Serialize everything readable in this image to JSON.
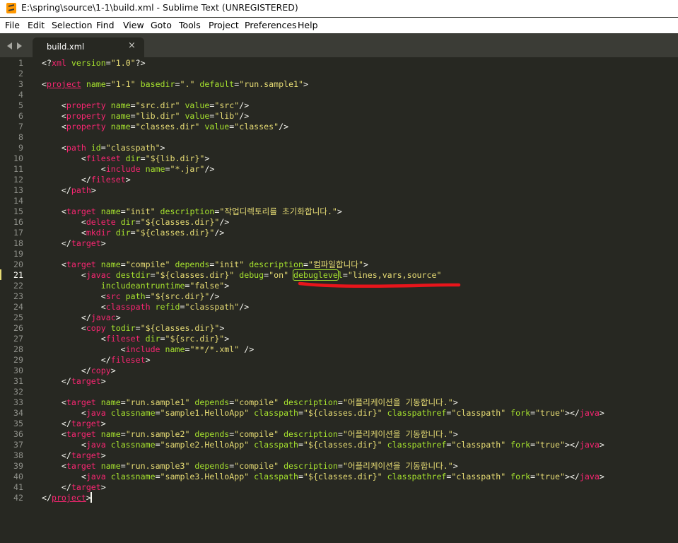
{
  "window": {
    "title": "E:\\spring\\source\\1-1\\build.xml - Sublime Text (UNREGISTERED)",
    "logo_icon": "sublime-text-logo"
  },
  "menu": [
    "File",
    "Edit",
    "Selection",
    "Find",
    "View",
    "Goto",
    "Tools",
    "Project",
    "Preferences",
    "Help"
  ],
  "tabs": [
    {
      "label": "build.xml",
      "close": "×",
      "active": true
    }
  ],
  "editor": {
    "active_line": 21,
    "colors": {
      "background": "#272822",
      "tag": "#f92672",
      "attribute": "#a6e22e",
      "string": "#e6db74",
      "text": "#f8f8f2",
      "line_number": "#8f908a",
      "annotation": "#e8151b"
    },
    "lines": [
      [
        [
          "p",
          "<?"
        ],
        [
          "t",
          "xml"
        ],
        [
          "a",
          " version"
        ],
        [
          "p",
          "="
        ],
        [
          "s",
          "\"1.0\""
        ],
        [
          "p",
          "?>"
        ]
      ],
      [],
      [
        [
          "p",
          "<"
        ],
        [
          "tu",
          "project"
        ],
        [
          "a",
          " name"
        ],
        [
          "p",
          "="
        ],
        [
          "s",
          "\"1-1\""
        ],
        [
          "a",
          " basedir"
        ],
        [
          "p",
          "="
        ],
        [
          "s",
          "\".\""
        ],
        [
          "a",
          " default"
        ],
        [
          "p",
          "="
        ],
        [
          "s",
          "\"run.sample1\""
        ],
        [
          "p",
          ">"
        ]
      ],
      [],
      [
        [
          "p",
          "    <"
        ],
        [
          "t",
          "property"
        ],
        [
          "a",
          " name"
        ],
        [
          "p",
          "="
        ],
        [
          "s",
          "\"src.dir\""
        ],
        [
          "a",
          " value"
        ],
        [
          "p",
          "="
        ],
        [
          "s",
          "\"src\""
        ],
        [
          "p",
          "/>"
        ]
      ],
      [
        [
          "p",
          "    <"
        ],
        [
          "t",
          "property"
        ],
        [
          "a",
          " name"
        ],
        [
          "p",
          "="
        ],
        [
          "s",
          "\"lib.dir\""
        ],
        [
          "a",
          " value"
        ],
        [
          "p",
          "="
        ],
        [
          "s",
          "\"lib\""
        ],
        [
          "p",
          "/>"
        ]
      ],
      [
        [
          "p",
          "    <"
        ],
        [
          "t",
          "property"
        ],
        [
          "a",
          " name"
        ],
        [
          "p",
          "="
        ],
        [
          "s",
          "\"classes.dir\""
        ],
        [
          "a",
          " value"
        ],
        [
          "p",
          "="
        ],
        [
          "s",
          "\"classes\""
        ],
        [
          "p",
          "/>"
        ]
      ],
      [],
      [
        [
          "p",
          "    <"
        ],
        [
          "t",
          "path"
        ],
        [
          "a",
          " id"
        ],
        [
          "p",
          "="
        ],
        [
          "s",
          "\"classpath\""
        ],
        [
          "p",
          ">"
        ]
      ],
      [
        [
          "p",
          "        <"
        ],
        [
          "t",
          "fileset"
        ],
        [
          "a",
          " dir"
        ],
        [
          "p",
          "="
        ],
        [
          "s",
          "\"${lib.dir}\""
        ],
        [
          "p",
          ">"
        ]
      ],
      [
        [
          "p",
          "            <"
        ],
        [
          "t",
          "include"
        ],
        [
          "a",
          " name"
        ],
        [
          "p",
          "="
        ],
        [
          "s",
          "\"*.jar\""
        ],
        [
          "p",
          "/>"
        ]
      ],
      [
        [
          "p",
          "        </"
        ],
        [
          "t",
          "fileset"
        ],
        [
          "p",
          ">"
        ]
      ],
      [
        [
          "p",
          "    </"
        ],
        [
          "t",
          "path"
        ],
        [
          "p",
          ">"
        ]
      ],
      [],
      [
        [
          "p",
          "    <"
        ],
        [
          "t",
          "target"
        ],
        [
          "a",
          " name"
        ],
        [
          "p",
          "="
        ],
        [
          "s",
          "\"init\""
        ],
        [
          "a",
          " description"
        ],
        [
          "p",
          "="
        ],
        [
          "s",
          "\"작업디렉토리를 초기화합니다.\""
        ],
        [
          "p",
          ">"
        ]
      ],
      [
        [
          "p",
          "        <"
        ],
        [
          "t",
          "delete"
        ],
        [
          "a",
          " dir"
        ],
        [
          "p",
          "="
        ],
        [
          "s",
          "\"${classes.dir}\""
        ],
        [
          "p",
          "/>"
        ]
      ],
      [
        [
          "p",
          "        <"
        ],
        [
          "t",
          "mkdir"
        ],
        [
          "a",
          " dir"
        ],
        [
          "p",
          "="
        ],
        [
          "s",
          "\"${classes.dir}\""
        ],
        [
          "p",
          "/>"
        ]
      ],
      [
        [
          "p",
          "    </"
        ],
        [
          "t",
          "target"
        ],
        [
          "p",
          ">"
        ]
      ],
      [],
      [
        [
          "p",
          "    <"
        ],
        [
          "t",
          "target"
        ],
        [
          "a",
          " name"
        ],
        [
          "p",
          "="
        ],
        [
          "s",
          "\"compile\""
        ],
        [
          "a",
          " depends"
        ],
        [
          "p",
          "="
        ],
        [
          "s",
          "\"init\""
        ],
        [
          "a",
          " description"
        ],
        [
          "p",
          "="
        ],
        [
          "s",
          "\"컴파일합니다\""
        ],
        [
          "p",
          ">"
        ]
      ],
      [
        [
          "p",
          "        <"
        ],
        [
          "t",
          "javac"
        ],
        [
          "a",
          " destdir"
        ],
        [
          "p",
          "="
        ],
        [
          "s",
          "\"${classes.dir}\""
        ],
        [
          "a",
          " debug"
        ],
        [
          "p",
          "="
        ],
        [
          "s",
          "\"on\""
        ],
        [
          "p",
          " "
        ],
        [
          "ab",
          "debugleve"
        ],
        [
          "a",
          "l"
        ],
        [
          "p",
          "="
        ],
        [
          "s",
          "\"lines,vars,source\""
        ]
      ],
      [
        [
          "a",
          "            includeantruntime"
        ],
        [
          "p",
          "="
        ],
        [
          "s",
          "\"false\""
        ],
        [
          "p",
          ">"
        ]
      ],
      [
        [
          "p",
          "            <"
        ],
        [
          "t",
          "src"
        ],
        [
          "a",
          " path"
        ],
        [
          "p",
          "="
        ],
        [
          "s",
          "\"${src.dir}\""
        ],
        [
          "p",
          "/>"
        ]
      ],
      [
        [
          "p",
          "            <"
        ],
        [
          "t",
          "classpath"
        ],
        [
          "a",
          " refid"
        ],
        [
          "p",
          "="
        ],
        [
          "s",
          "\"classpath\""
        ],
        [
          "p",
          "/>"
        ]
      ],
      [
        [
          "p",
          "        </"
        ],
        [
          "t",
          "javac"
        ],
        [
          "p",
          ">"
        ]
      ],
      [
        [
          "p",
          "        <"
        ],
        [
          "t",
          "copy"
        ],
        [
          "a",
          " todir"
        ],
        [
          "p",
          "="
        ],
        [
          "s",
          "\"${classes.dir}\""
        ],
        [
          "p",
          ">"
        ]
      ],
      [
        [
          "p",
          "            <"
        ],
        [
          "t",
          "fileset"
        ],
        [
          "a",
          " dir"
        ],
        [
          "p",
          "="
        ],
        [
          "s",
          "\"${src.dir}\""
        ],
        [
          "p",
          ">"
        ]
      ],
      [
        [
          "p",
          "                <"
        ],
        [
          "t",
          "include"
        ],
        [
          "a",
          " name"
        ],
        [
          "p",
          "="
        ],
        [
          "s",
          "\"**/*.xml\""
        ],
        [
          "p",
          " />"
        ]
      ],
      [
        [
          "p",
          "            </"
        ],
        [
          "t",
          "fileset"
        ],
        [
          "p",
          ">"
        ]
      ],
      [
        [
          "p",
          "        </"
        ],
        [
          "t",
          "copy"
        ],
        [
          "p",
          ">"
        ]
      ],
      [
        [
          "p",
          "    </"
        ],
        [
          "t",
          "target"
        ],
        [
          "p",
          ">"
        ]
      ],
      [],
      [
        [
          "p",
          "    <"
        ],
        [
          "t",
          "target"
        ],
        [
          "a",
          " name"
        ],
        [
          "p",
          "="
        ],
        [
          "s",
          "\"run.sample1\""
        ],
        [
          "a",
          " depends"
        ],
        [
          "p",
          "="
        ],
        [
          "s",
          "\"compile\""
        ],
        [
          "a",
          " description"
        ],
        [
          "p",
          "="
        ],
        [
          "s",
          "\"어플리케이션을 기동합니다.\""
        ],
        [
          "p",
          ">"
        ]
      ],
      [
        [
          "p",
          "        <"
        ],
        [
          "t",
          "java"
        ],
        [
          "a",
          " classname"
        ],
        [
          "p",
          "="
        ],
        [
          "s",
          "\"sample1.HelloApp\""
        ],
        [
          "a",
          " classpath"
        ],
        [
          "p",
          "="
        ],
        [
          "s",
          "\"${classes.dir}\""
        ],
        [
          "a",
          " classpathref"
        ],
        [
          "p",
          "="
        ],
        [
          "s",
          "\"classpath\""
        ],
        [
          "a",
          " fork"
        ],
        [
          "p",
          "="
        ],
        [
          "s",
          "\"true\""
        ],
        [
          "p",
          "></"
        ],
        [
          "t",
          "java"
        ],
        [
          "p",
          ">"
        ]
      ],
      [
        [
          "p",
          "    </"
        ],
        [
          "t",
          "target"
        ],
        [
          "p",
          ">"
        ]
      ],
      [
        [
          "p",
          "    <"
        ],
        [
          "t",
          "target"
        ],
        [
          "a",
          " name"
        ],
        [
          "p",
          "="
        ],
        [
          "s",
          "\"run.sample2\""
        ],
        [
          "a",
          " depends"
        ],
        [
          "p",
          "="
        ],
        [
          "s",
          "\"compile\""
        ],
        [
          "a",
          " description"
        ],
        [
          "p",
          "="
        ],
        [
          "s",
          "\"어플리케이션을 기동합니다.\""
        ],
        [
          "p",
          ">"
        ]
      ],
      [
        [
          "p",
          "        <"
        ],
        [
          "t",
          "java"
        ],
        [
          "a",
          " classname"
        ],
        [
          "p",
          "="
        ],
        [
          "s",
          "\"sample2.HelloApp\""
        ],
        [
          "a",
          " classpath"
        ],
        [
          "p",
          "="
        ],
        [
          "s",
          "\"${classes.dir}\""
        ],
        [
          "a",
          " classpathref"
        ],
        [
          "p",
          "="
        ],
        [
          "s",
          "\"classpath\""
        ],
        [
          "a",
          " fork"
        ],
        [
          "p",
          "="
        ],
        [
          "s",
          "\"true\""
        ],
        [
          "p",
          "></"
        ],
        [
          "t",
          "java"
        ],
        [
          "p",
          ">"
        ]
      ],
      [
        [
          "p",
          "    </"
        ],
        [
          "t",
          "target"
        ],
        [
          "p",
          ">"
        ]
      ],
      [
        [
          "p",
          "    <"
        ],
        [
          "t",
          "target"
        ],
        [
          "a",
          " name"
        ],
        [
          "p",
          "="
        ],
        [
          "s",
          "\"run.sample3\""
        ],
        [
          "a",
          " depends"
        ],
        [
          "p",
          "="
        ],
        [
          "s",
          "\"compile\""
        ],
        [
          "a",
          " description"
        ],
        [
          "p",
          "="
        ],
        [
          "s",
          "\"어플리케이션을 기동합니다.\""
        ],
        [
          "p",
          ">"
        ]
      ],
      [
        [
          "p",
          "        <"
        ],
        [
          "t",
          "java"
        ],
        [
          "a",
          " classname"
        ],
        [
          "p",
          "="
        ],
        [
          "s",
          "\"sample3.HelloApp\""
        ],
        [
          "a",
          " classpath"
        ],
        [
          "p",
          "="
        ],
        [
          "s",
          "\"${classes.dir}\""
        ],
        [
          "a",
          " classpathref"
        ],
        [
          "p",
          "="
        ],
        [
          "s",
          "\"classpath\""
        ],
        [
          "a",
          " fork"
        ],
        [
          "p",
          "="
        ],
        [
          "s",
          "\"true\""
        ],
        [
          "p",
          "></"
        ],
        [
          "t",
          "java"
        ],
        [
          "p",
          ">"
        ]
      ],
      [
        [
          "p",
          "    </"
        ],
        [
          "t",
          "target"
        ],
        [
          "p",
          ">"
        ]
      ],
      [
        [
          "p",
          "</"
        ],
        [
          "tu",
          "project"
        ],
        [
          "p",
          ">"
        ]
      ]
    ]
  }
}
